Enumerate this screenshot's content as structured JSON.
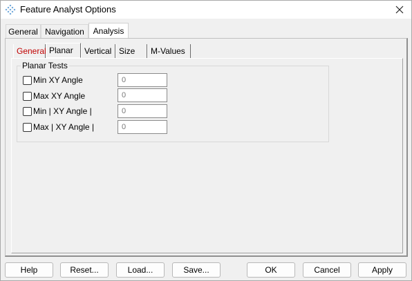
{
  "window": {
    "title": "Feature Analyst Options"
  },
  "tabs": [
    {
      "label": "General"
    },
    {
      "label": "Navigation"
    },
    {
      "label": "Analysis"
    }
  ],
  "subtabs": [
    {
      "label": "General"
    },
    {
      "label": "Planar"
    },
    {
      "label": "Vertical"
    },
    {
      "label": "Size"
    },
    {
      "label": "M-Values"
    }
  ],
  "group": {
    "label": "Planar Tests"
  },
  "tests": [
    {
      "label": "Min XY Angle",
      "value": "0",
      "checked": false
    },
    {
      "label": "Max XY Angle",
      "value": "0",
      "checked": false
    },
    {
      "label": "Min | XY Angle |",
      "value": "0",
      "checked": false
    },
    {
      "label": "Max | XY Angle |",
      "value": "0",
      "checked": false
    }
  ],
  "buttons": {
    "help": "Help",
    "reset": "Reset...",
    "load": "Load...",
    "save": "Save...",
    "ok": "OK",
    "cancel": "Cancel",
    "apply": "Apply"
  },
  "colors": {
    "active_subtab_text": "#c00000",
    "app_icon": "#5a9bd5"
  }
}
